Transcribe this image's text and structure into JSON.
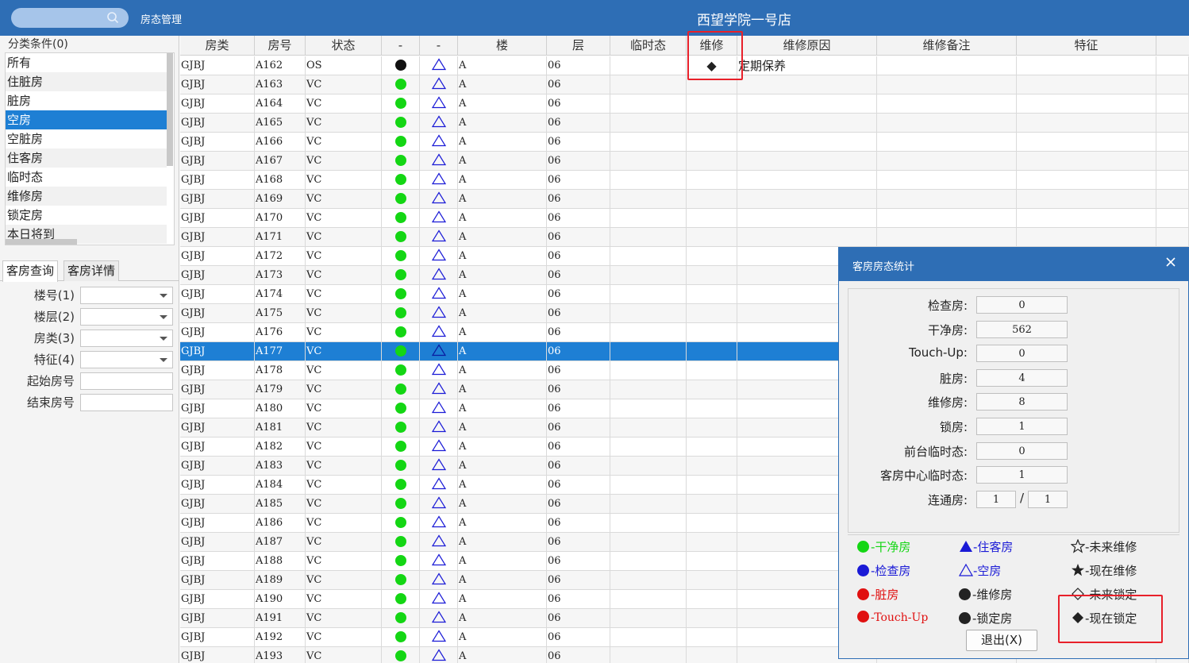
{
  "titlebar": {
    "module_title": "房态管理",
    "hotel_title": "西望学院一号店"
  },
  "left": {
    "category_header": "分类条件(0)",
    "categories": [
      "所有",
      "住脏房",
      "脏房",
      "空房",
      "空脏房",
      "住客房",
      "临时态",
      "维修房",
      "锁定房",
      "本日将到"
    ],
    "selected_category": "空房",
    "tabs": [
      "客房查询",
      "客房详情"
    ],
    "form": {
      "building_label": "楼号(1)",
      "floor_label": "楼层(2)",
      "room_type_label": "房类(3)",
      "feature_label": "特征(4)",
      "start_room_label": "起始房号",
      "end_room_label": "结束房号"
    }
  },
  "grid": {
    "columns": [
      "房类",
      "房号",
      "状态",
      "-",
      "-",
      "楼",
      "层",
      "临时态",
      "维修",
      "维修原因",
      "维修备注",
      "特征"
    ],
    "rows": [
      {
        "type": "GJBJ",
        "room": "A162",
        "status": "OS",
        "dot": "black",
        "tri": "outline",
        "bldg": "A",
        "floor": "06",
        "maint": "◆",
        "reason": "定期保养"
      },
      {
        "type": "GJBJ",
        "room": "A163",
        "status": "VC",
        "dot": "green",
        "tri": "outline",
        "bldg": "A",
        "floor": "06",
        "maint": "",
        "reason": ""
      },
      {
        "type": "GJBJ",
        "room": "A164",
        "status": "VC",
        "dot": "green",
        "tri": "outline",
        "bldg": "A",
        "floor": "06",
        "maint": "",
        "reason": ""
      },
      {
        "type": "GJBJ",
        "room": "A165",
        "status": "VC",
        "dot": "green",
        "tri": "outline",
        "bldg": "A",
        "floor": "06",
        "maint": "",
        "reason": ""
      },
      {
        "type": "GJBJ",
        "room": "A166",
        "status": "VC",
        "dot": "green",
        "tri": "outline",
        "bldg": "A",
        "floor": "06",
        "maint": "",
        "reason": ""
      },
      {
        "type": "GJBJ",
        "room": "A167",
        "status": "VC",
        "dot": "green",
        "tri": "outline",
        "bldg": "A",
        "floor": "06",
        "maint": "",
        "reason": ""
      },
      {
        "type": "GJBJ",
        "room": "A168",
        "status": "VC",
        "dot": "green",
        "tri": "outline",
        "bldg": "A",
        "floor": "06",
        "maint": "",
        "reason": ""
      },
      {
        "type": "GJBJ",
        "room": "A169",
        "status": "VC",
        "dot": "green",
        "tri": "outline",
        "bldg": "A",
        "floor": "06",
        "maint": "",
        "reason": ""
      },
      {
        "type": "GJBJ",
        "room": "A170",
        "status": "VC",
        "dot": "green",
        "tri": "outline",
        "bldg": "A",
        "floor": "06",
        "maint": "",
        "reason": ""
      },
      {
        "type": "GJBJ",
        "room": "A171",
        "status": "VC",
        "dot": "green",
        "tri": "outline",
        "bldg": "A",
        "floor": "06",
        "maint": "",
        "reason": ""
      },
      {
        "type": "GJBJ",
        "room": "A172",
        "status": "VC",
        "dot": "green",
        "tri": "outline",
        "bldg": "A",
        "floor": "06",
        "maint": "",
        "reason": ""
      },
      {
        "type": "GJBJ",
        "room": "A173",
        "status": "VC",
        "dot": "green",
        "tri": "outline",
        "bldg": "A",
        "floor": "06",
        "maint": "",
        "reason": ""
      },
      {
        "type": "GJBJ",
        "room": "A174",
        "status": "VC",
        "dot": "green",
        "tri": "outline",
        "bldg": "A",
        "floor": "06",
        "maint": "",
        "reason": ""
      },
      {
        "type": "GJBJ",
        "room": "A175",
        "status": "VC",
        "dot": "green",
        "tri": "outline",
        "bldg": "A",
        "floor": "06",
        "maint": "",
        "reason": ""
      },
      {
        "type": "GJBJ",
        "room": "A176",
        "status": "VC",
        "dot": "green",
        "tri": "outline",
        "bldg": "A",
        "floor": "06",
        "maint": "",
        "reason": ""
      },
      {
        "type": "GJBJ",
        "room": "A177",
        "status": "VC",
        "dot": "green",
        "tri": "outline",
        "bldg": "A",
        "floor": "06",
        "maint": "",
        "reason": "",
        "selected": true
      },
      {
        "type": "GJBJ",
        "room": "A178",
        "status": "VC",
        "dot": "green",
        "tri": "outline",
        "bldg": "A",
        "floor": "06",
        "maint": "",
        "reason": ""
      },
      {
        "type": "GJBJ",
        "room": "A179",
        "status": "VC",
        "dot": "green",
        "tri": "outline",
        "bldg": "A",
        "floor": "06",
        "maint": "",
        "reason": ""
      },
      {
        "type": "GJBJ",
        "room": "A180",
        "status": "VC",
        "dot": "green",
        "tri": "outline",
        "bldg": "A",
        "floor": "06",
        "maint": "",
        "reason": ""
      },
      {
        "type": "GJBJ",
        "room": "A181",
        "status": "VC",
        "dot": "green",
        "tri": "outline",
        "bldg": "A",
        "floor": "06",
        "maint": "",
        "reason": ""
      },
      {
        "type": "GJBJ",
        "room": "A182",
        "status": "VC",
        "dot": "green",
        "tri": "outline",
        "bldg": "A",
        "floor": "06",
        "maint": "",
        "reason": ""
      },
      {
        "type": "GJBJ",
        "room": "A183",
        "status": "VC",
        "dot": "green",
        "tri": "outline",
        "bldg": "A",
        "floor": "06",
        "maint": "",
        "reason": ""
      },
      {
        "type": "GJBJ",
        "room": "A184",
        "status": "VC",
        "dot": "green",
        "tri": "outline",
        "bldg": "A",
        "floor": "06",
        "maint": "",
        "reason": ""
      },
      {
        "type": "GJBJ",
        "room": "A185",
        "status": "VC",
        "dot": "green",
        "tri": "outline",
        "bldg": "A",
        "floor": "06",
        "maint": "",
        "reason": ""
      },
      {
        "type": "GJBJ",
        "room": "A186",
        "status": "VC",
        "dot": "green",
        "tri": "outline",
        "bldg": "A",
        "floor": "06",
        "maint": "",
        "reason": ""
      },
      {
        "type": "GJBJ",
        "room": "A187",
        "status": "VC",
        "dot": "green",
        "tri": "outline",
        "bldg": "A",
        "floor": "06",
        "maint": "",
        "reason": ""
      },
      {
        "type": "GJBJ",
        "room": "A188",
        "status": "VC",
        "dot": "green",
        "tri": "outline",
        "bldg": "A",
        "floor": "06",
        "maint": "",
        "reason": ""
      },
      {
        "type": "GJBJ",
        "room": "A189",
        "status": "VC",
        "dot": "green",
        "tri": "outline",
        "bldg": "A",
        "floor": "06",
        "maint": "",
        "reason": ""
      },
      {
        "type": "GJBJ",
        "room": "A190",
        "status": "VC",
        "dot": "green",
        "tri": "outline",
        "bldg": "A",
        "floor": "06",
        "maint": "",
        "reason": ""
      },
      {
        "type": "GJBJ",
        "room": "A191",
        "status": "VC",
        "dot": "green",
        "tri": "outline",
        "bldg": "A",
        "floor": "06",
        "maint": "",
        "reason": ""
      },
      {
        "type": "GJBJ",
        "room": "A192",
        "status": "VC",
        "dot": "green",
        "tri": "outline",
        "bldg": "A",
        "floor": "06",
        "maint": "",
        "reason": ""
      },
      {
        "type": "GJBJ",
        "room": "A193",
        "status": "VC",
        "dot": "green",
        "tri": "outline",
        "bldg": "A",
        "floor": "06",
        "maint": "",
        "reason": ""
      }
    ]
  },
  "dialog": {
    "title": "客房房态统计",
    "stats": [
      {
        "label": "检查房:",
        "value": "0"
      },
      {
        "label": "干净房:",
        "value": "562"
      },
      {
        "label": "Touch-Up:",
        "value": "0"
      },
      {
        "label": "脏房:",
        "value": "4"
      },
      {
        "label": "维修房:",
        "value": "8"
      },
      {
        "label": "锁房:",
        "value": "1"
      },
      {
        "label": "前台临时态:",
        "value": "0"
      },
      {
        "label": "客房中心临时态:",
        "value": "1"
      }
    ],
    "link_label": "连通房:",
    "link_value_1": "1",
    "link_sep": "/",
    "link_value_2": "1",
    "legend": [
      {
        "text": "-干净房",
        "icon": "green-dot",
        "color": "#14d614"
      },
      {
        "text": "-住客房",
        "icon": "filled-triangle",
        "color": "#1a1ad6"
      },
      {
        "text": "-未来维修",
        "icon": "outline-star",
        "color": "#222222"
      },
      {
        "text": "-检查房",
        "icon": "blue-dot",
        "color": "#1a1ad6"
      },
      {
        "text": "-空房",
        "icon": "outline-triangle",
        "color": "#1a1ad6"
      },
      {
        "text": "-现在维修",
        "icon": "filled-star",
        "color": "#222222"
      },
      {
        "text": "-脏房",
        "icon": "red-dot",
        "color": "#e01010"
      },
      {
        "text": "-维修房",
        "icon": "black-dot",
        "color": "#222222"
      },
      {
        "text": "-未来锁定",
        "icon": "outline-diamond",
        "color": "#222222"
      },
      {
        "text": "-Touch-Up",
        "icon": "red-dot",
        "color": "#e01010"
      },
      {
        "text": "-锁定房",
        "icon": "black-dot",
        "color": "#222222"
      },
      {
        "text": "-现在锁定",
        "icon": "filled-diamond",
        "color": "#222222"
      }
    ],
    "exit_label": "退出(X)"
  },
  "colors": {
    "title_bar": "#2e6eb5",
    "selection": "#1e7fd4",
    "clean_dot": "#14d614",
    "triangle": "#1a1ad6",
    "highlight_box": "#e8202a"
  }
}
